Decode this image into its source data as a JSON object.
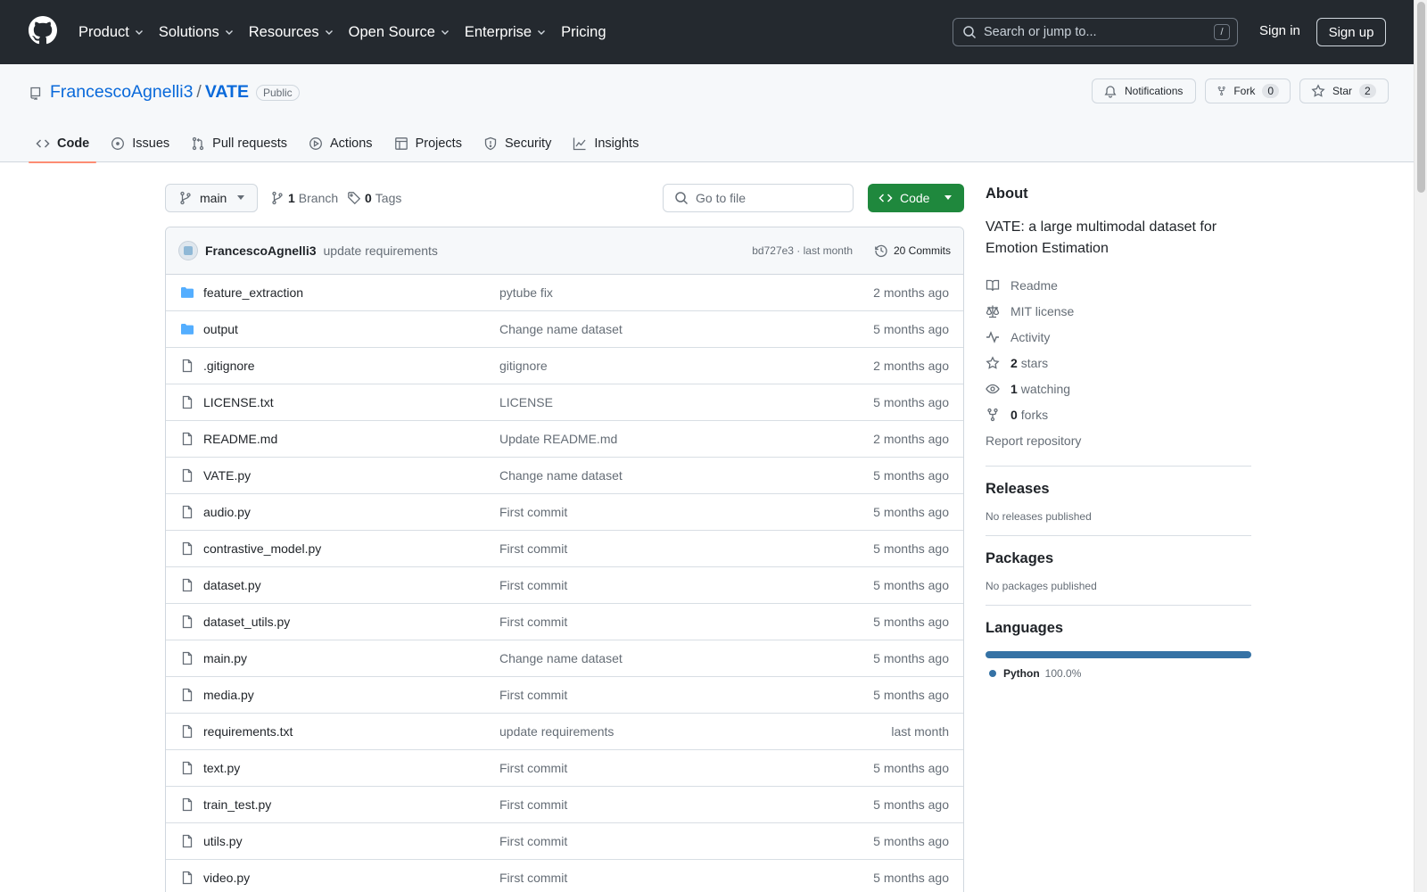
{
  "topnav": {
    "items": [
      "Product",
      "Solutions",
      "Resources",
      "Open Source",
      "Enterprise",
      "Pricing"
    ],
    "search_placeholder": "Search or jump to...",
    "search_shortcut": "/",
    "signin": "Sign in",
    "signup": "Sign up"
  },
  "repo": {
    "owner": "FrancescoAgnelli3",
    "separator": "/",
    "name": "VATE",
    "visibility": "Public",
    "notifications_label": "Notifications",
    "fork_label": "Fork",
    "fork_count": "0",
    "star_label": "Star",
    "star_count": "2"
  },
  "tabs": [
    {
      "label": "Code",
      "icon": "code-icon"
    },
    {
      "label": "Issues",
      "icon": "issue-icon"
    },
    {
      "label": "Pull requests",
      "icon": "pull-request-icon"
    },
    {
      "label": "Actions",
      "icon": "play-icon"
    },
    {
      "label": "Projects",
      "icon": "table-icon"
    },
    {
      "label": "Security",
      "icon": "shield-icon"
    },
    {
      "label": "Insights",
      "icon": "graph-icon"
    }
  ],
  "toolbar": {
    "branch": "main",
    "branch_count": "1",
    "branch_label": "Branch",
    "tag_count": "0",
    "tag_label": "Tags",
    "gofile_placeholder": "Go to file",
    "code_label": "Code"
  },
  "latest_commit": {
    "author": "FrancescoAgnelli3",
    "message": "update requirements",
    "hash_time": "bd727e3 · last month",
    "commits": "20 Commits"
  },
  "files": [
    {
      "name": "feature_extraction",
      "type": "dir",
      "message": "pytube fix",
      "date": "2 months ago"
    },
    {
      "name": "output",
      "type": "dir",
      "message": "Change name dataset",
      "date": "5 months ago"
    },
    {
      "name": ".gitignore",
      "type": "file",
      "message": "gitignore",
      "date": "2 months ago"
    },
    {
      "name": "LICENSE.txt",
      "type": "file",
      "message": "LICENSE",
      "date": "5 months ago"
    },
    {
      "name": "README.md",
      "type": "file",
      "message": "Update README.md",
      "date": "2 months ago"
    },
    {
      "name": "VATE.py",
      "type": "file",
      "message": "Change name dataset",
      "date": "5 months ago"
    },
    {
      "name": "audio.py",
      "type": "file",
      "message": "First commit",
      "date": "5 months ago"
    },
    {
      "name": "contrastive_model.py",
      "type": "file",
      "message": "First commit",
      "date": "5 months ago"
    },
    {
      "name": "dataset.py",
      "type": "file",
      "message": "First commit",
      "date": "5 months ago"
    },
    {
      "name": "dataset_utils.py",
      "type": "file",
      "message": "First commit",
      "date": "5 months ago"
    },
    {
      "name": "main.py",
      "type": "file",
      "message": "Change name dataset",
      "date": "5 months ago"
    },
    {
      "name": "media.py",
      "type": "file",
      "message": "First commit",
      "date": "5 months ago"
    },
    {
      "name": "requirements.txt",
      "type": "file",
      "message": "update requirements",
      "date": "last month"
    },
    {
      "name": "text.py",
      "type": "file",
      "message": "First commit",
      "date": "5 months ago"
    },
    {
      "name": "train_test.py",
      "type": "file",
      "message": "First commit",
      "date": "5 months ago"
    },
    {
      "name": "utils.py",
      "type": "file",
      "message": "First commit",
      "date": "5 months ago"
    },
    {
      "name": "video.py",
      "type": "file",
      "message": "First commit",
      "date": "5 months ago"
    }
  ],
  "about": {
    "title": "About",
    "description": "VATE: a large multimodal dataset for Emotion Estimation",
    "readme": "Readme",
    "license": "MIT license",
    "activity": "Activity",
    "stars_count": "2",
    "stars_label": "stars",
    "watching_count": "1",
    "watching_label": "watching",
    "forks_count": "0",
    "forks_label": "forks",
    "report": "Report repository"
  },
  "releases": {
    "title": "Releases",
    "text": "No releases published"
  },
  "packages": {
    "title": "Packages",
    "text": "No packages published"
  },
  "languages": {
    "title": "Languages",
    "items": [
      {
        "name": "Python",
        "percent": "100.0%",
        "fraction": 1.0,
        "color": "#3572A5"
      }
    ]
  },
  "colors": {
    "header_bg": "#24292f",
    "link": "#0969da",
    "primary_button": "#1f883d",
    "active_tab_underline": "#fd8c73",
    "folder_icon": "#54aeff"
  }
}
